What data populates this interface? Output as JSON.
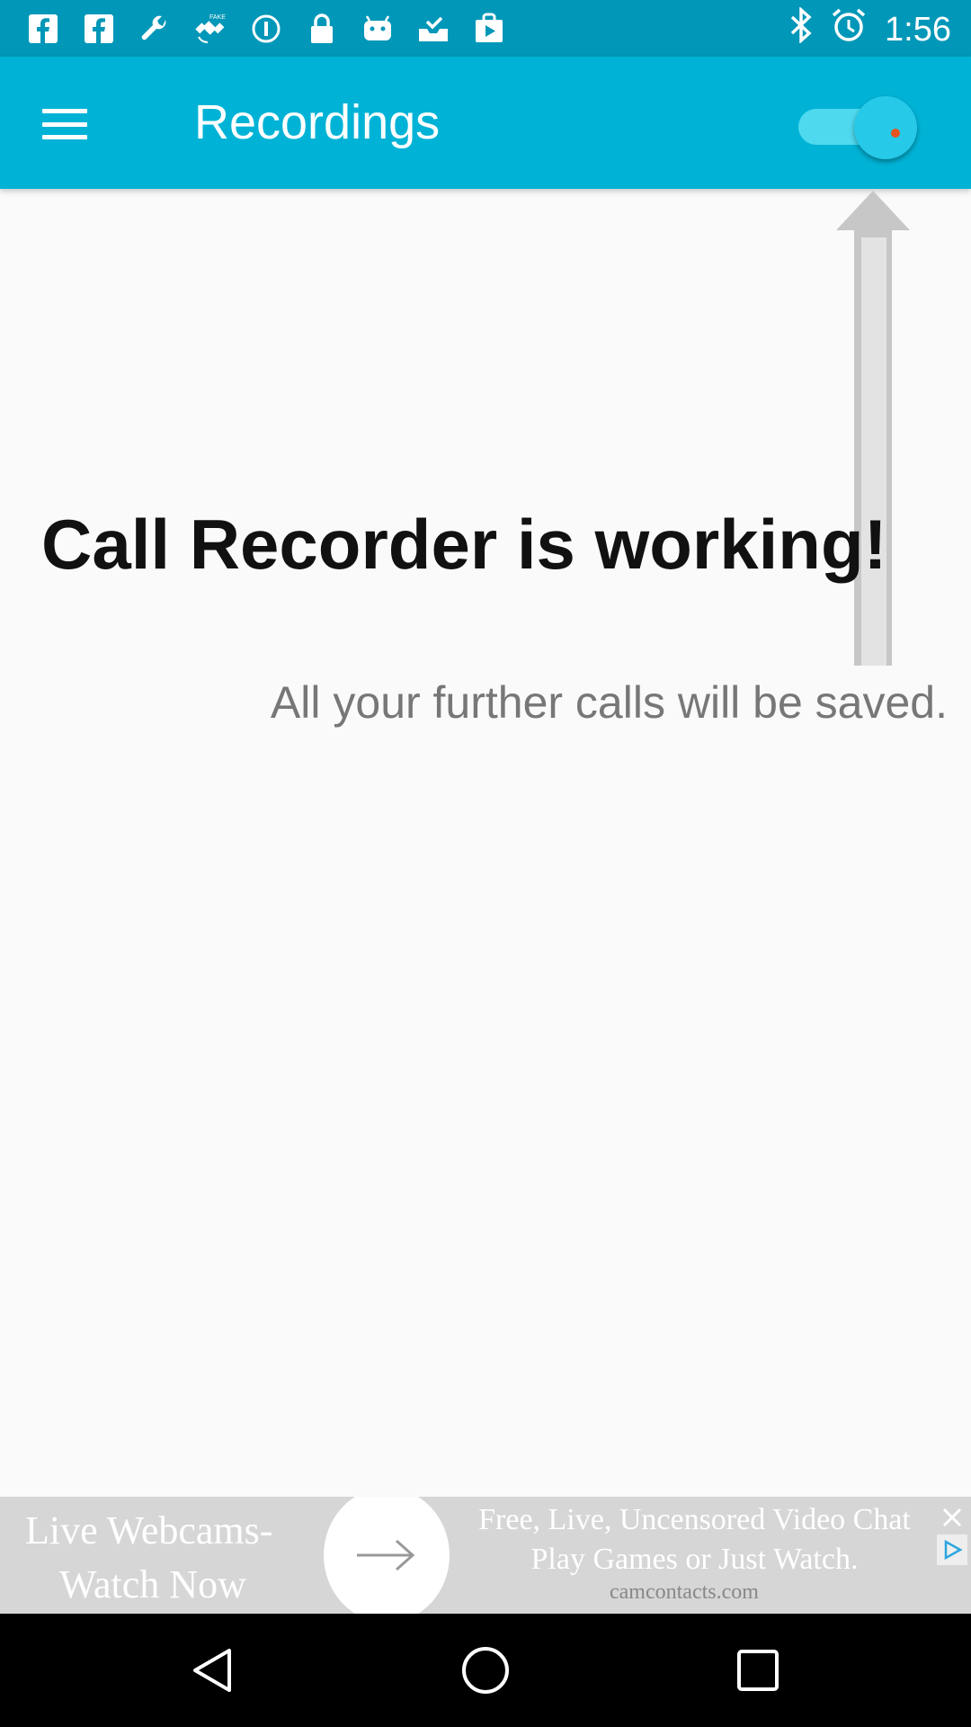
{
  "status_bar": {
    "time": "1:56",
    "left_icons": [
      "facebook-icon",
      "facebook-icon",
      "wrench-icon",
      "fake-gps-icon",
      "circle-info-icon",
      "lock-icon",
      "android-icon",
      "inbox-check-icon",
      "play-store-icon"
    ],
    "right_icons": [
      "bluetooth-icon",
      "alarm-icon"
    ]
  },
  "app_bar": {
    "title": "Recordings",
    "menu_icon": "hamburger-menu-icon",
    "toggle_on": true,
    "colors": {
      "app_bar": "#00b3d6",
      "status_bar": "#0097b8"
    }
  },
  "main": {
    "headline": "Call Recorder is working!",
    "subtext": "All your further calls will be saved."
  },
  "ad": {
    "left_text_line1": "Live Webcams-",
    "left_text_line2": "Watch Now",
    "right_text_line1": "Free, Live, Uncensored Video Chat",
    "right_text_line2": "Play Games or Just Watch.",
    "domain": "camcontacts.com"
  },
  "nav_bar": {
    "buttons": [
      "back-icon",
      "home-icon",
      "recents-icon"
    ]
  }
}
